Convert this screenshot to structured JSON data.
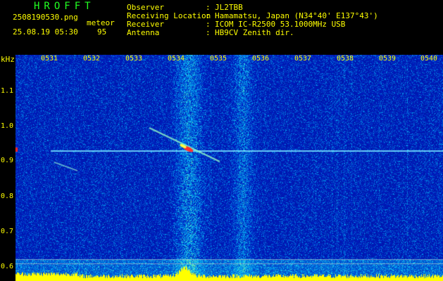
{
  "header": {
    "app_title": "HROFFT",
    "filename": "2508190530.png",
    "datetime": "25.08.19 05:30",
    "meteor_label": "meteor",
    "meteor_count": "95",
    "info": [
      {
        "label": "Observer",
        "value": "JL2TBB"
      },
      {
        "label": "Receiving Location",
        "value": "Hamamatsu, Japan (N34°40' E137°43')"
      },
      {
        "label": "Receiver",
        "value": "ICOM IC-R2500 53.1000MHz USB"
      },
      {
        "label": "Antenna",
        "value": "HB9CV Zenith dir."
      }
    ],
    "colon": ":"
  },
  "spectrogram": {
    "y_unit": "kHz",
    "y_ticks": [
      "1.1",
      "1.0",
      "0.9",
      "0.8",
      "0.7",
      "0.6"
    ],
    "x_ticks": [
      "0531",
      "0532",
      "0533",
      "0534",
      "0535",
      "0536",
      "0537",
      "0538",
      "0539",
      "0540"
    ],
    "colors": {
      "label": "#ffff00",
      "title": "#22ff22",
      "background": "#000000",
      "noise": "#0a1a8a"
    }
  }
}
